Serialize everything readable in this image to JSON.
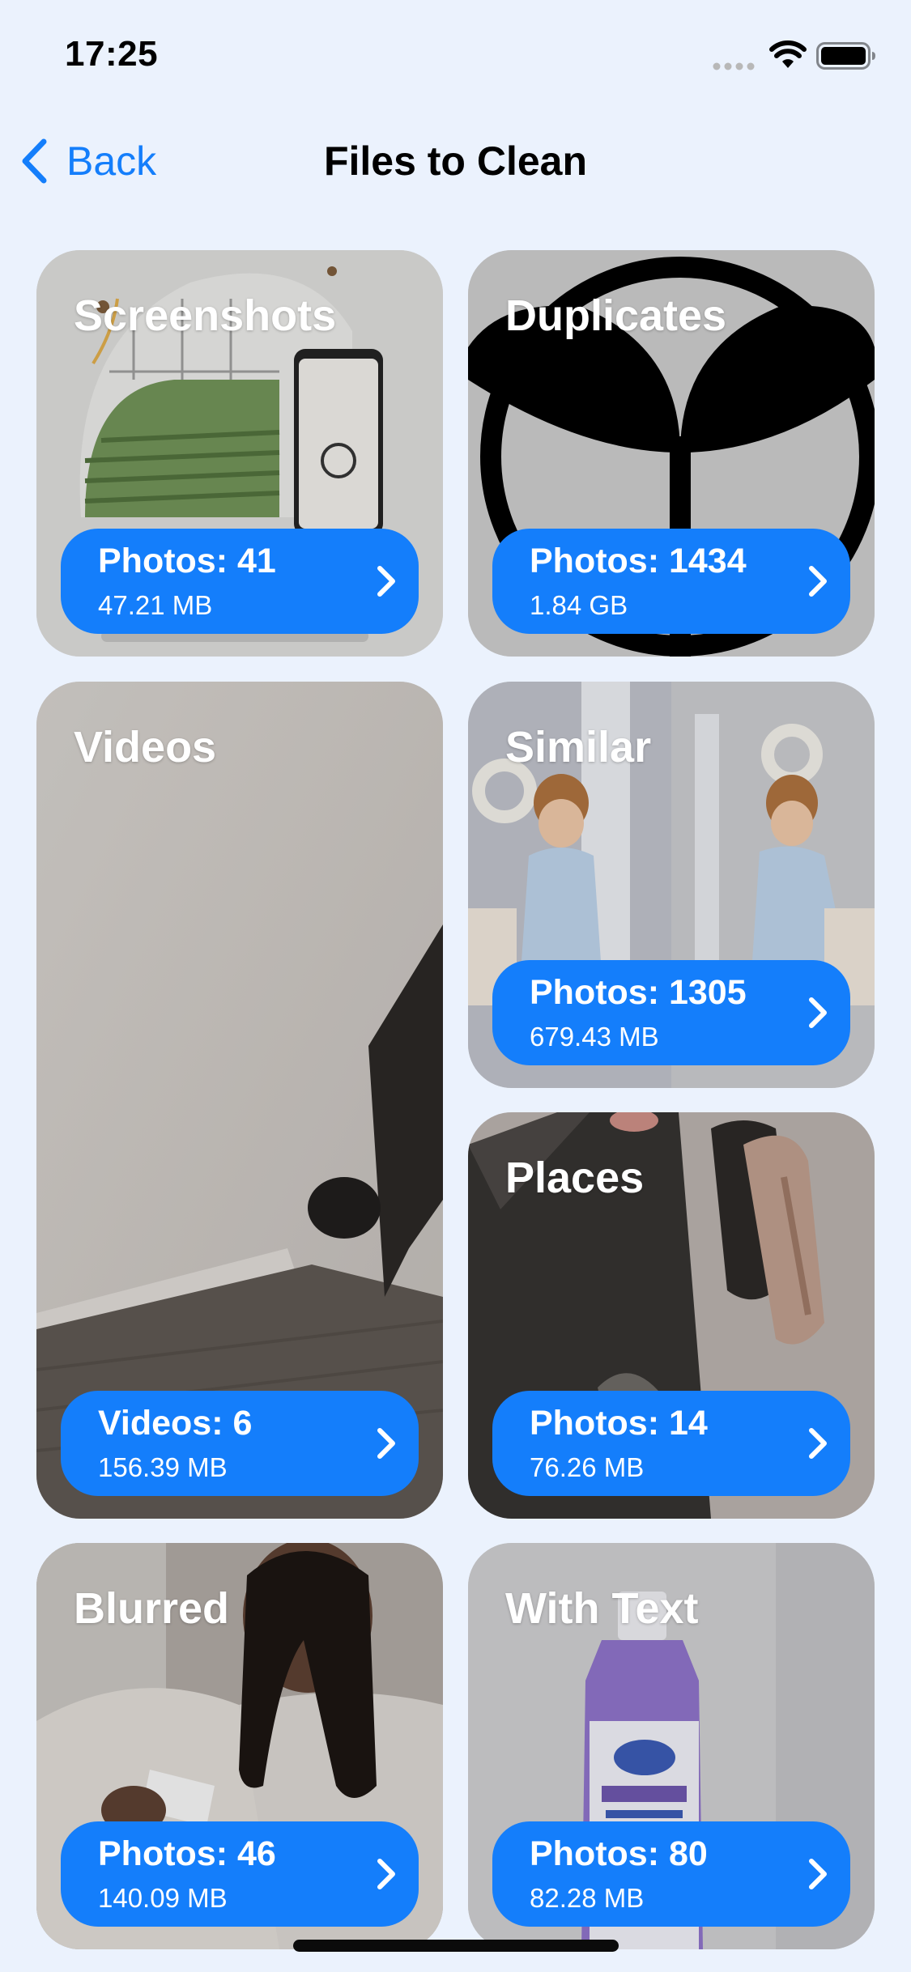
{
  "status_bar": {
    "time": "17:25"
  },
  "nav": {
    "back_label": "Back",
    "title": "Files to Clean"
  },
  "cards": {
    "screenshots": {
      "title": "Screenshots",
      "count": "Photos: 41",
      "size": "47.21 MB"
    },
    "duplicates": {
      "title": "Duplicates",
      "count": "Photos: 1434",
      "size": "1.84 GB"
    },
    "videos": {
      "title": "Videos",
      "count": "Videos: 6",
      "size": "156.39 MB"
    },
    "similar": {
      "title": "Similar",
      "count": "Photos: 1305",
      "size": "679.43 MB"
    },
    "places": {
      "title": "Places",
      "count": "Photos: 14",
      "size": "76.26 MB"
    },
    "blurred": {
      "title": "Blurred",
      "count": "Photos: 46",
      "size": "140.09 MB"
    },
    "with_text": {
      "title": "With Text",
      "count": "Photos: 80",
      "size": "82.28 MB"
    }
  },
  "colors": {
    "background": "#ebf2fd",
    "accent": "#147efb",
    "text": "#000000"
  }
}
